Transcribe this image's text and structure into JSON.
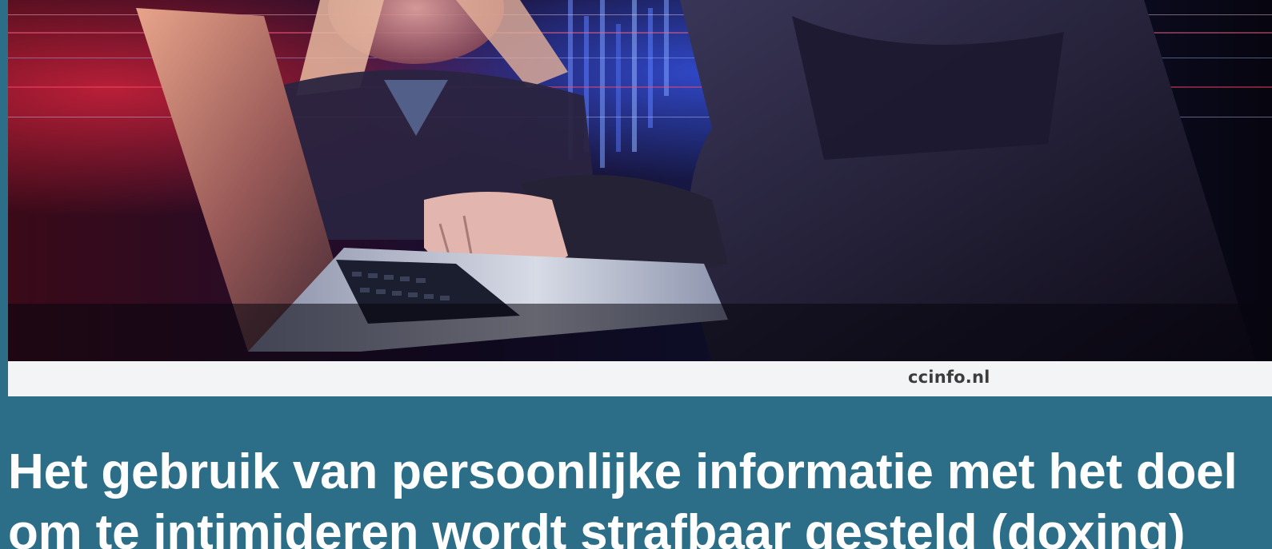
{
  "hero_image": {
    "description_icon": "hero-photo",
    "colors": {
      "background": "#0a0716",
      "glow_red": "#c0223a",
      "glow_blue": "#3a5cff"
    }
  },
  "caption": {
    "source": "ccinfo.nl"
  },
  "article": {
    "title": "Het gebruik van persoonlijke informatie met het doel om te intimideren wordt strafbaar gesteld (doxing)"
  },
  "theme": {
    "page_background": "#2c6e88",
    "caption_background": "#f2f4f6",
    "title_color": "#ffffff"
  }
}
